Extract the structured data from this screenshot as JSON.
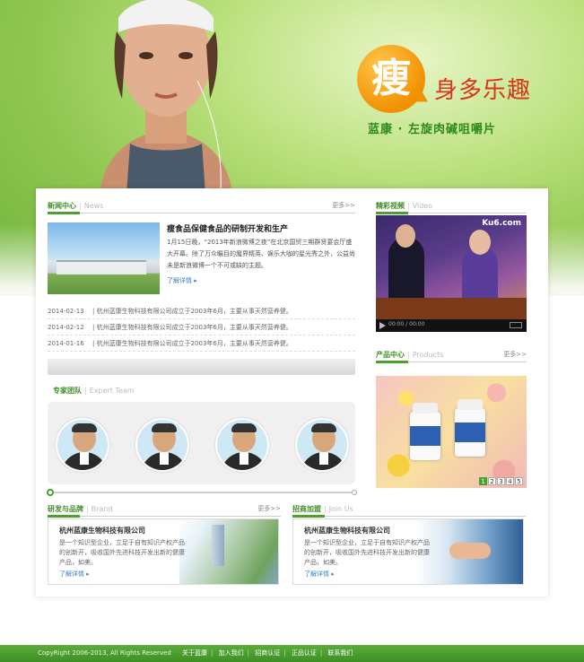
{
  "hero": {
    "brand_char": "瘦",
    "slogan": "身多乐趣",
    "subslogan": "蓝康 · 左旋肉碱咀嚼片"
  },
  "news": {
    "title_cn": "新闻中心",
    "title_en": "News",
    "more": "更多>>",
    "headline": "瘦食品保健食品的研制开发和生产",
    "desc": "1月15日晚，“2013年新浪微博之夜”在北京国贸三期群贤宴会厅盛大开幕。除了万众瞩目的魔界精英、娱乐大咖的星光秀之外，公益尚未是新浪微博一个不可或缺的主题。",
    "read_more": "了解详情",
    "items": [
      {
        "date": "2014-02-13",
        "text": "杭州蓝康生物科技有限公司成立于2003年6月，主要从事天然营养健。"
      },
      {
        "date": "2014-02-12",
        "text": "杭州蓝康生物科技有限公司成立于2003年6月，主要从事天然营养健。"
      },
      {
        "date": "2014-01-16",
        "text": "杭州蓝康生物科技有限公司成立于2003年6月，主要从事天然营养健。"
      }
    ]
  },
  "experts": {
    "title_cn": "专家团队",
    "title_en": "Expert Team"
  },
  "rd": {
    "title_cn": "研发与品牌",
    "title_en": "Brand",
    "more": "更多>>",
    "card_title": "杭州蓝康生物科技有限公司",
    "card_desc": "是一个知识型企业，立足于自有知识产权产品的创新开，吸收国外先进科技开发出新的健康产品，如美。",
    "card_more": "了解详情"
  },
  "join": {
    "title_cn": "招商加盟",
    "title_en": "Join Us",
    "card_title": "杭州蓝康生物科技有限公司",
    "card_desc": "是一个知识型企业，立足于自有知识产权产品的创新开，吸收国外先进科技开发出新的健康产品，如美。",
    "card_more": "了解详情"
  },
  "video": {
    "title_cn": "精彩视频",
    "title_en": "Video",
    "logo": "Ku6.com",
    "time": "00:00 / 00:00"
  },
  "products": {
    "title_cn": "产品中心",
    "title_en": "Products",
    "more": "更多>>",
    "pages": [
      "1",
      "2",
      "3",
      "4",
      "5"
    ]
  },
  "footer": {
    "copyright": "CopyRight 2006-2013, All Rights Reserved",
    "links": [
      "关于蓝康",
      "加入我们",
      "招商认证",
      "正品认证",
      "联系我们"
    ]
  },
  "colors": {
    "accent": "#4aa12c",
    "brand_orange": "#f19100",
    "slogan_red": "#d9341c"
  }
}
